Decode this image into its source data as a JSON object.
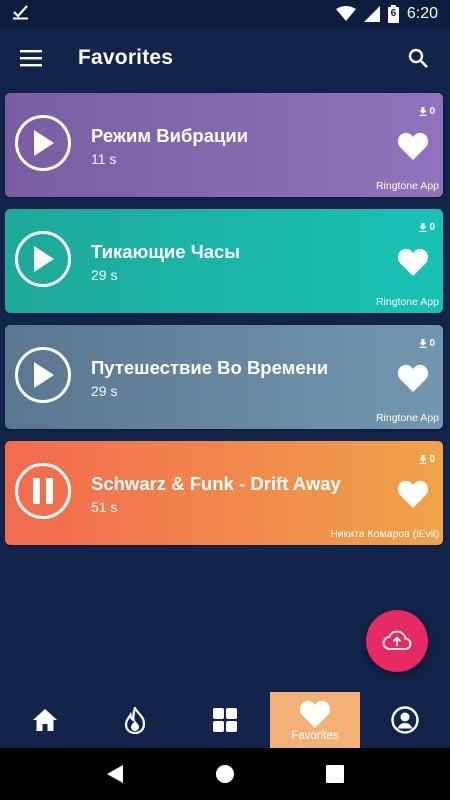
{
  "status_bar": {
    "time": "6:20",
    "battery_level": "6",
    "icons": [
      "check-icon",
      "wifi-icon",
      "signal-icon",
      "battery-icon"
    ]
  },
  "app_bar": {
    "title": "Favorites",
    "menu_icon": "menu-icon",
    "search_icon": "search-icon"
  },
  "songs": [
    {
      "title": "Режим Вибрации",
      "duration": "11 s",
      "downloads": "0",
      "author": "Ringtone App",
      "state": "play"
    },
    {
      "title": "Тикающие Часы",
      "duration": "29 s",
      "downloads": "0",
      "author": "Ringtone App",
      "state": "play"
    },
    {
      "title": "Путешествие Во Времени",
      "duration": "29 s",
      "downloads": "0",
      "author": "Ringtone App",
      "state": "play"
    },
    {
      "title": "Schwarz & Funk - Drift Away",
      "duration": "51 s",
      "downloads": "0",
      "author": "Никита Комаров (iEvil)",
      "state": "pause"
    }
  ],
  "fab": {
    "icon": "cloud-upload-icon"
  },
  "bottom_nav": {
    "items": [
      {
        "icon": "home-icon",
        "label": ""
      },
      {
        "icon": "fire-icon",
        "label": ""
      },
      {
        "icon": "grid-icon",
        "label": ""
      },
      {
        "icon": "heart-icon",
        "label": "Favorites",
        "active": true
      },
      {
        "icon": "profile-icon",
        "label": ""
      }
    ]
  },
  "colors": {
    "background": "#13244a",
    "card_purple": "#8f74bd",
    "card_teal": "#17c2b5",
    "card_slate": "#7397b0",
    "card_orange": "#f0a34a",
    "fab": "#e72a61",
    "nav_active": "#f2b277"
  }
}
